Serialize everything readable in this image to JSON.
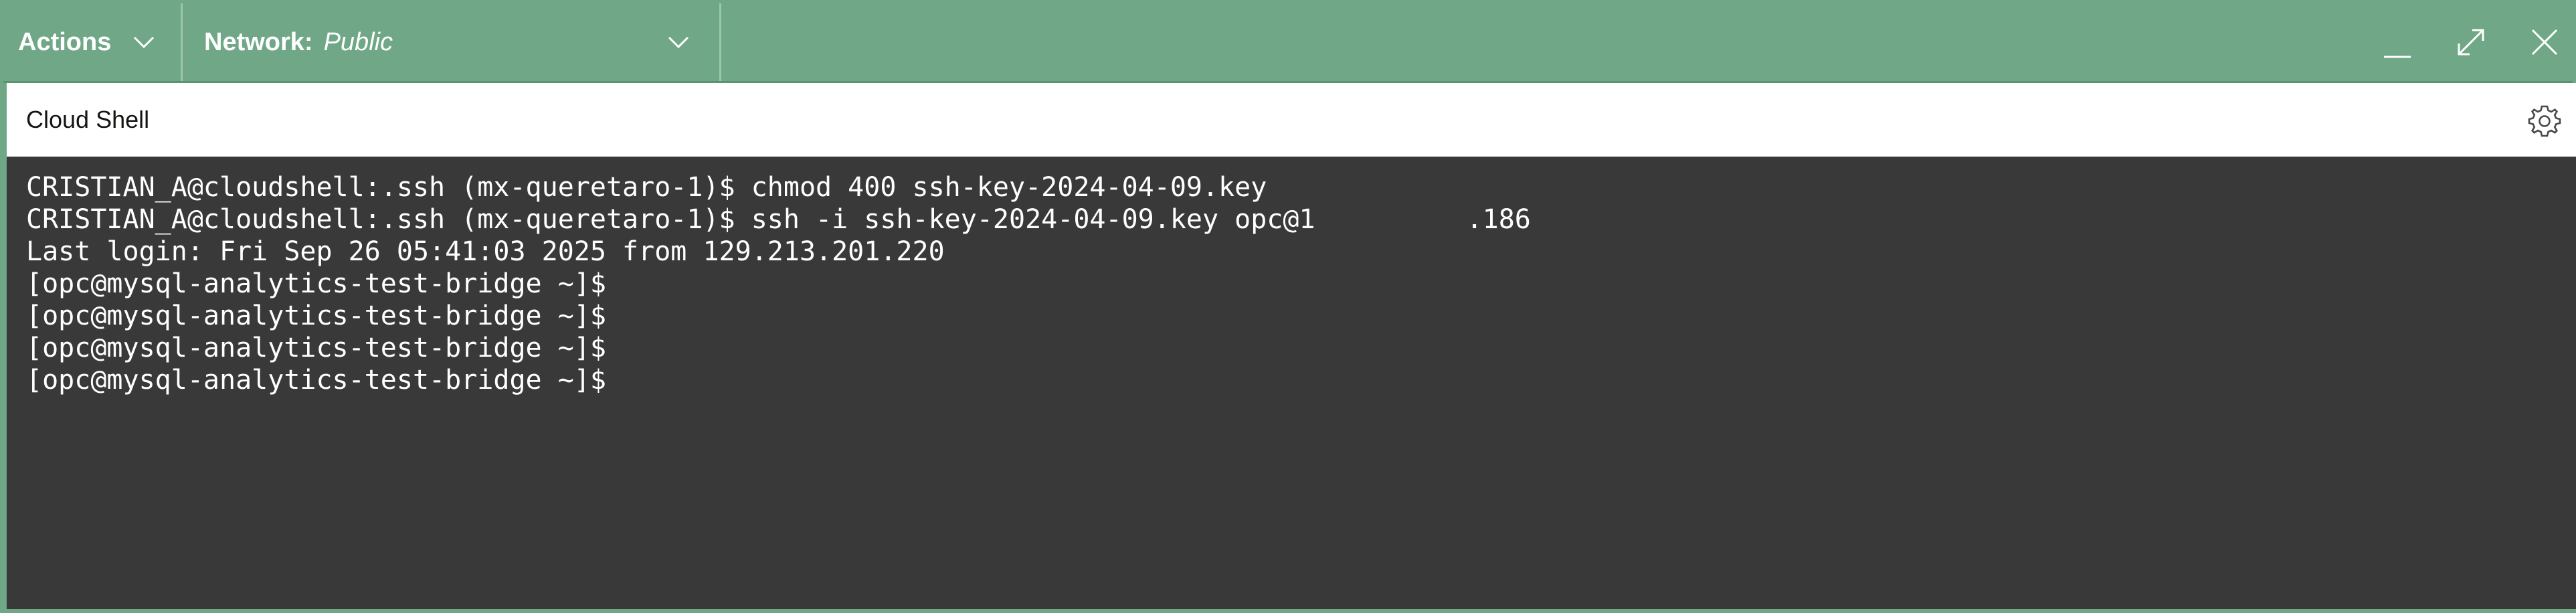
{
  "toolbar": {
    "actions_label": "Actions",
    "network_label": "Network:",
    "network_value": "Public"
  },
  "window": {
    "title": "Cloud Shell"
  },
  "icons": {
    "actions_chevron": "chevron-down-icon",
    "network_chevron": "chevron-down-icon",
    "minimize": "minimize-icon",
    "maximize": "maximize-icon",
    "close": "close-icon",
    "settings": "gear-icon"
  },
  "colors": {
    "toolbar_bg": "#6fa787",
    "terminal_bg": "#393939",
    "terminal_fg": "#ffffff",
    "titlebar_bg": "#ffffff"
  },
  "terminal": {
    "lines": [
      "CRISTIAN_A@cloudshell:.ssh (mx-queretaro-1)$ chmod 400 ssh-key-2024-04-09.key",
      "CRISTIAN_A@cloudshell:.ssh (mx-queretaro-1)$ ssh -i ssh-key-2024-04-09.key opc@1",
      "Last login: Fri Sep 26 05:41:03 2025 from 129.213.201.220",
      "[opc@mysql-analytics-test-bridge ~]$",
      "[opc@mysql-analytics-test-bridge ~]$",
      "[opc@mysql-analytics-test-bridge ~]$",
      "[opc@mysql-analytics-test-bridge ~]$"
    ],
    "line2_suffix": ".186"
  }
}
